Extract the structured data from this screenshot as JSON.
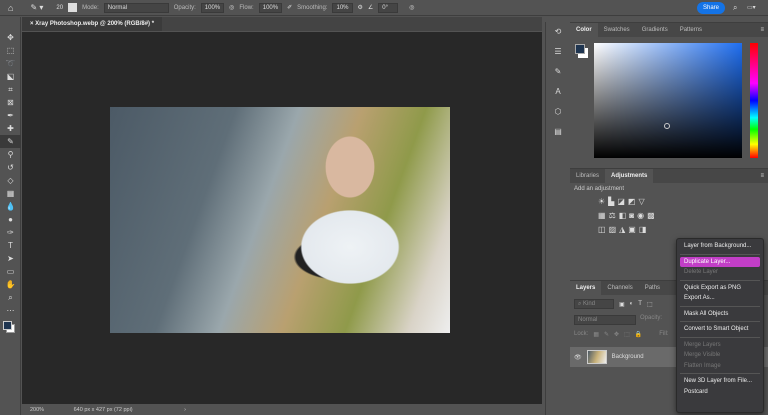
{
  "options_bar": {
    "brush_size": "20",
    "mode_label": "Mode:",
    "mode_value": "Normal",
    "opacity_label": "Opacity:",
    "opacity_value": "100%",
    "flow_label": "Flow:",
    "flow_value": "100%",
    "smoothing_label": "Smoothing:",
    "smoothing_value": "10%",
    "angle_value": "0°",
    "share_label": "Share"
  },
  "document_tab": {
    "title": "Xray Photoshop.webp @ 200% (RGB/8#) *"
  },
  "status_bar": {
    "zoom": "200%",
    "dimensions": "640 px x 427 px (72 ppi)"
  },
  "color_panel": {
    "tabs": [
      "Color",
      "Swatches",
      "Gradients",
      "Patterns"
    ],
    "foreground": "#1f3550",
    "background": "#ffffff"
  },
  "adjustments_panel": {
    "tabs": [
      "Libraries",
      "Adjustments"
    ],
    "hint": "Add an adjustment"
  },
  "layers_panel": {
    "tabs": [
      "Layers",
      "Channels",
      "Paths"
    ],
    "filter_placeholder": "Kind",
    "blend_mode": "Normal",
    "opacity_label": "Opacity:",
    "lock_label": "Lock:",
    "fill_label": "Fill:",
    "layer_name": "Background"
  },
  "context_menu": {
    "items": [
      "Layer from Background...",
      "Duplicate Layer...",
      "Delete Layer",
      "Quick Export as PNG",
      "Export As...",
      "Mask All Objects",
      "Convert to Smart Object",
      "Merge Layers",
      "Merge Visible",
      "Flatten Image",
      "New 3D Layer from File...",
      "Postcard"
    ],
    "highlight_color": "#c23ec7"
  },
  "accent": "#1473e6"
}
